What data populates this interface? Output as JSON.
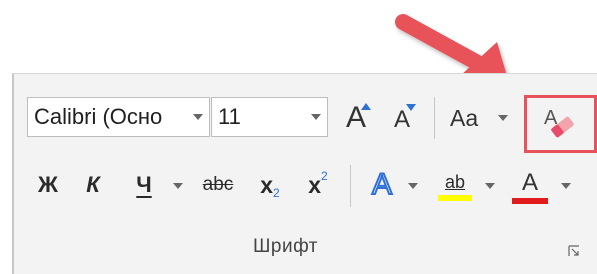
{
  "font_group": {
    "font_name": "Calibri (Осно",
    "font_size": "11",
    "grow_font_label": "A",
    "shrink_font_label": "A",
    "change_case_label": "Aa",
    "bold_label": "Ж",
    "italic_label": "К",
    "underline_label": "Ч",
    "strikethrough_label": "abc",
    "subscript_label": "x",
    "subscript_mark": "2",
    "superscript_label": "x",
    "superscript_mark": "2",
    "text_effects_label": "A",
    "highlight_label": "ab",
    "font_color_label": "A",
    "group_name": "Шрифт"
  },
  "colors": {
    "highlight_yellow": "#ffff00",
    "font_color_red": "#e11b1b",
    "callout_red": "#e8525a",
    "text_effects_blue": "#2f6fd6"
  },
  "icons": {
    "clear_formatting": "eraser-icon",
    "dialog_launcher": "dialog-launcher-icon"
  }
}
